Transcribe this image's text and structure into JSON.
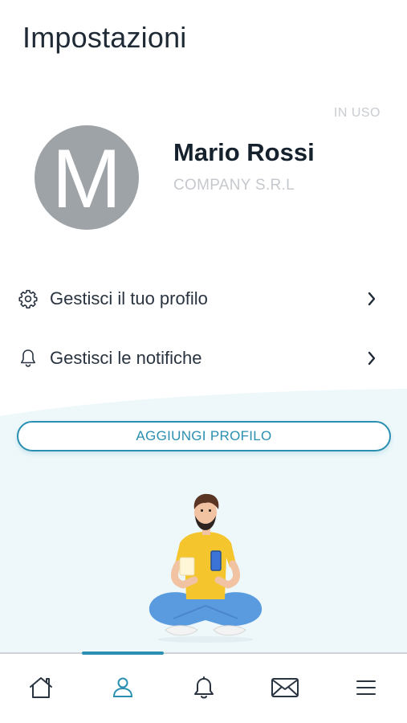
{
  "page": {
    "title": "Impostazioni"
  },
  "profile": {
    "status": "IN USO",
    "avatar_letter": "M",
    "name": "Mario Rossi",
    "company": "COMPANY S.R.L"
  },
  "menu": {
    "items": [
      {
        "label": "Gestisci il tuo profilo",
        "icon": "gear-icon"
      },
      {
        "label": "Gestisci le notifiche",
        "icon": "bell-icon"
      }
    ]
  },
  "actions": {
    "add_profile": "AGGIUNGI PROFILO"
  },
  "tabs": [
    {
      "name": "home",
      "icon": "home-icon",
      "active": false
    },
    {
      "name": "profile",
      "icon": "user-icon",
      "active": true
    },
    {
      "name": "notifications",
      "icon": "bell-icon",
      "active": false
    },
    {
      "name": "messages",
      "icon": "envelope-icon",
      "active": false
    },
    {
      "name": "menu",
      "icon": "hamburger-menu-icon",
      "active": false
    }
  ],
  "colors": {
    "accent": "#2a8fb0",
    "avatar_bg": "#9ea3a8",
    "muted_text": "#c5c9ce",
    "light_bg": "#eef8fb"
  }
}
